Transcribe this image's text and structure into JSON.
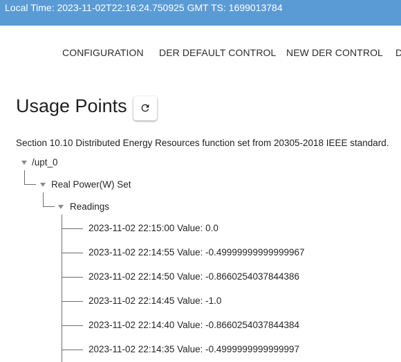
{
  "topbar": {
    "text": "Local Time: 2023-11-02T22:16:24.750925 GMT TS: 1699013784"
  },
  "nav": {
    "tabs": [
      {
        "label": "CONFIGURATION"
      },
      {
        "label": "DER DEFAULT CONTROL"
      },
      {
        "label": "NEW DER CONTROL"
      },
      {
        "label": "D"
      }
    ]
  },
  "page": {
    "title": "Usage Points",
    "refresh_icon": "refresh-icon",
    "description": "Section 10.10 Distributed Energy Resources function set from 20305-2018 IEEE standard."
  },
  "tree": {
    "root": {
      "label": "/upt_0"
    },
    "reading_set": {
      "label": "Real Power(W) Set"
    },
    "readings_group": {
      "label": "Readings"
    },
    "readings": [
      {
        "label": "2023-11-02 22:15:00 Value: 0.0"
      },
      {
        "label": "2023-11-02 22:14:55 Value: -0.49999999999999967"
      },
      {
        "label": "2023-11-02 22:14:50 Value: -0.8660254037844386"
      },
      {
        "label": "2023-11-02 22:14:45 Value: -1.0"
      },
      {
        "label": "2023-11-02 22:14:40 Value: -0.8660254037844384"
      },
      {
        "label": "2023-11-02 22:14:35 Value: -0.4999999999999997"
      }
    ]
  },
  "colors": {
    "topbar": "#5b9bd5",
    "tree_line": "#6b6b6b",
    "caret": "#8a8a8a"
  }
}
